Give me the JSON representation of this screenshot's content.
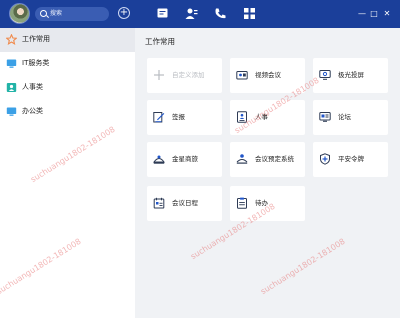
{
  "titlebar": {
    "search_placeholder": "搜索",
    "add_symbol": "+",
    "window": {
      "minimize": "—",
      "maximize": "□",
      "close": "✕"
    }
  },
  "sidebar": {
    "items": [
      {
        "label": "工作常用",
        "icon": "star-icon",
        "color": "#f08a4b",
        "active": true
      },
      {
        "label": "IT服务类",
        "icon": "monitor-icon",
        "color": "#3ba0e6",
        "active": false
      },
      {
        "label": "人事类",
        "icon": "person-card-icon",
        "color": "#22b3a7",
        "active": false
      },
      {
        "label": "办公类",
        "icon": "monitor-icon",
        "color": "#3ba0e6",
        "active": false
      }
    ]
  },
  "main": {
    "section_title": "工作常用",
    "cards": [
      {
        "label": "自定义添加",
        "icon": "plus-icon",
        "disabled": true
      },
      {
        "label": "视频会议",
        "icon": "video-icon",
        "disabled": false
      },
      {
        "label": "极光投屏",
        "icon": "screen-cast-icon",
        "disabled": false
      },
      {
        "label": "签报",
        "icon": "sign-pen-icon",
        "disabled": false
      },
      {
        "label": "人事",
        "icon": "person-doc-icon",
        "disabled": false
      },
      {
        "label": "论坛",
        "icon": "forum-icon",
        "disabled": false
      },
      {
        "label": "金星商旅",
        "icon": "travel-icon",
        "disabled": false
      },
      {
        "label": "会议预定系统",
        "icon": "meeting-room-icon",
        "disabled": false
      },
      {
        "label": "平安令牌",
        "icon": "shield-token-icon",
        "disabled": false
      },
      {
        "label": "会议日程",
        "icon": "calendar-icon",
        "disabled": false
      },
      {
        "label": "待办",
        "icon": "todo-icon",
        "disabled": false
      }
    ]
  },
  "watermark": {
    "text": "suchuangu1802-181008"
  },
  "colors": {
    "titlebar": "#1b3f9a",
    "accent": "#2156c9",
    "background": "#f0f2f5"
  }
}
